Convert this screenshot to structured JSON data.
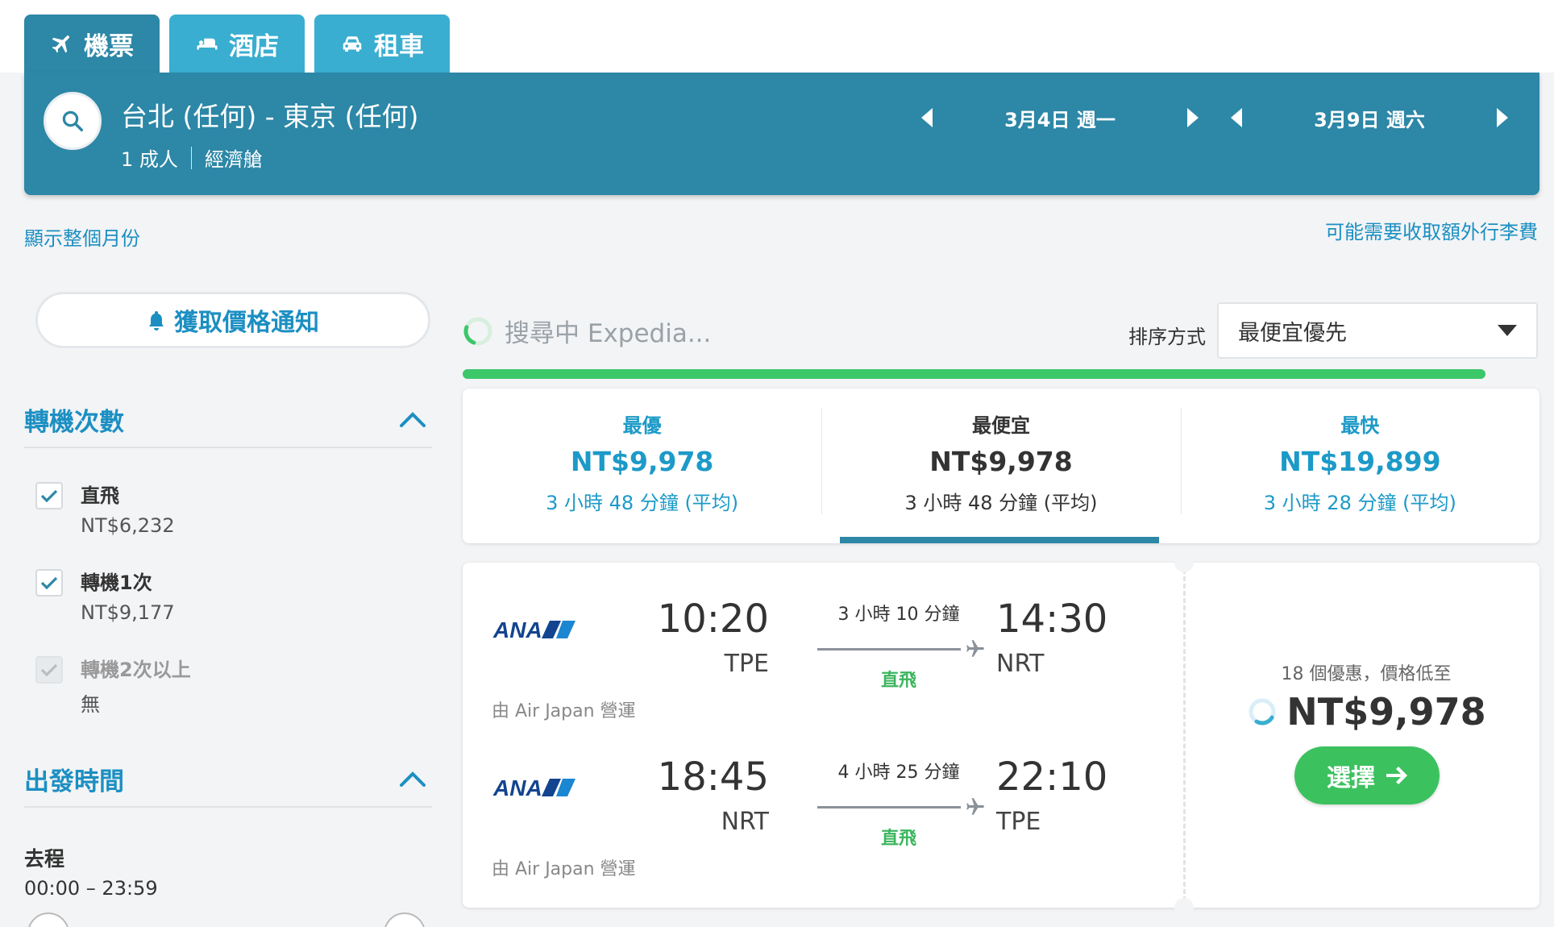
{
  "tabs": [
    {
      "label": "機票",
      "icon": "plane-icon",
      "active": true
    },
    {
      "label": "酒店",
      "icon": "bed-icon",
      "active": false
    },
    {
      "label": "租車",
      "icon": "car-icon",
      "active": false
    }
  ],
  "search": {
    "route": "台北 (任何) - 東京 (任何)",
    "passengers": "1 成人",
    "cabin": "經濟艙",
    "depart_date": "3月4日 週一",
    "return_date": "3月9日 週六"
  },
  "links": {
    "show_month": "顯示整個月份",
    "baggage_fee": "可能需要收取額外行李費"
  },
  "sidebar": {
    "price_alert": "獲取價格通知",
    "stops_title": "轉機次數",
    "stops": [
      {
        "label": "直飛",
        "price": "NT$6,232",
        "checked": true,
        "disabled": false
      },
      {
        "label": "轉機1次",
        "price": "NT$9,177",
        "checked": true,
        "disabled": false
      },
      {
        "label": "轉機2次以上",
        "price": "無",
        "checked": true,
        "disabled": true
      }
    ],
    "departure_title": "出發時間",
    "outbound_label": "去程",
    "outbound_range": "00:00 – 23:59"
  },
  "status": {
    "searching": "搜尋中 Expedia...",
    "sort_label": "排序方式",
    "sort_value": "最便宜優先",
    "progress_fraction": 0.95
  },
  "summary": [
    {
      "title": "最優",
      "price": "NT$9,978",
      "duration": "3 小時 48 分鐘 (平均)"
    },
    {
      "title": "最便宜",
      "price": "NT$9,978",
      "duration": "3 小時 48 分鐘 (平均)"
    },
    {
      "title": "最快",
      "price": "NT$19,899",
      "duration": "3 小時 28 分鐘 (平均)"
    }
  ],
  "result": {
    "legs": [
      {
        "airline": "ANA",
        "dep_time": "10:20",
        "dep_code": "TPE",
        "duration": "3 小時 10 分鐘",
        "stops": "直飛",
        "arr_time": "14:30",
        "arr_code": "NRT",
        "operator": "由 Air Japan 營運"
      },
      {
        "airline": "ANA",
        "dep_time": "18:45",
        "dep_code": "NRT",
        "duration": "4 小時 25 分鐘",
        "stops": "直飛",
        "arr_time": "22:10",
        "arr_code": "TPE",
        "operator": "由 Air Japan 營運"
      }
    ],
    "deals": "18 個優惠，價格低至",
    "price": "NT$9,978",
    "select_label": "選擇"
  },
  "colors": {
    "primary": "#2d87a6",
    "tab": "#3aaed0",
    "link": "#1c8fc2",
    "green": "#3cc15f"
  }
}
